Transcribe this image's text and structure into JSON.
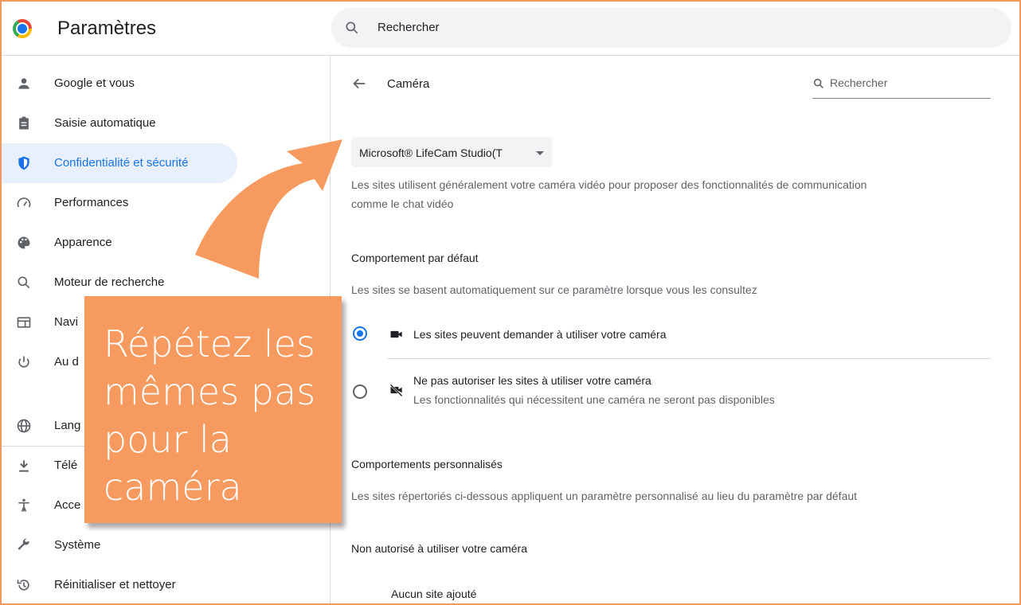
{
  "header": {
    "title": "Paramètres",
    "search_placeholder": "Rechercher"
  },
  "sidebar": {
    "items": [
      {
        "label": "Google et vous",
        "icon": "person-icon"
      },
      {
        "label": "Saisie automatique",
        "icon": "clipboard-icon"
      },
      {
        "label": "Confidentialité et sécurité",
        "icon": "shield-icon",
        "active": true
      },
      {
        "label": "Performances",
        "icon": "speedometer-icon"
      },
      {
        "label": "Apparence",
        "icon": "palette-icon"
      },
      {
        "label": "Moteur de recherche",
        "icon": "search-icon"
      },
      {
        "label": "Navi",
        "icon": "browser-icon"
      },
      {
        "label": "Au d",
        "icon": "power-icon"
      },
      {
        "label": "Lang",
        "icon": "globe-icon"
      },
      {
        "label": "Télé",
        "icon": "download-icon"
      },
      {
        "label": "Acce",
        "icon": "accessibility-icon"
      },
      {
        "label": "Système",
        "icon": "wrench-icon"
      },
      {
        "label": "Réinitialiser et nettoyer",
        "icon": "restore-icon"
      }
    ]
  },
  "main": {
    "title": "Caméra",
    "search_placeholder": "Rechercher",
    "camera_select": "Microsoft® LifeCam Studio(T",
    "description_line1": "Les sites utilisent généralement votre caméra vidéo pour proposer des fonctionnalités de communication",
    "description_line2": "comme le chat vidéo",
    "default_heading": "Comportement par défaut",
    "default_text": "Les sites se basent automatiquement sur ce paramètre lorsque vous les consultez",
    "option_allow": "Les sites peuvent demander à utiliser votre caméra",
    "option_block_title": "Ne pas autoriser les sites à utiliser votre caméra",
    "option_block_sub": "Les fonctionnalités qui nécessitent une caméra ne seront pas disponibles",
    "custom_heading": "Comportements personnalisés",
    "custom_text": "Les sites répertoriés ci-dessous appliquent un paramètre personnalisé au lieu du paramètre par défaut",
    "blocked_label": "Non autorisé à utiliser votre caméra",
    "no_site": "Aucun site ajouté"
  },
  "callout": {
    "text": "Répétez les mêmes pas pour la caméra"
  },
  "colors": {
    "accent": "#1a73e8",
    "callout": "#f79a5f",
    "frame": "#f59a5e"
  }
}
